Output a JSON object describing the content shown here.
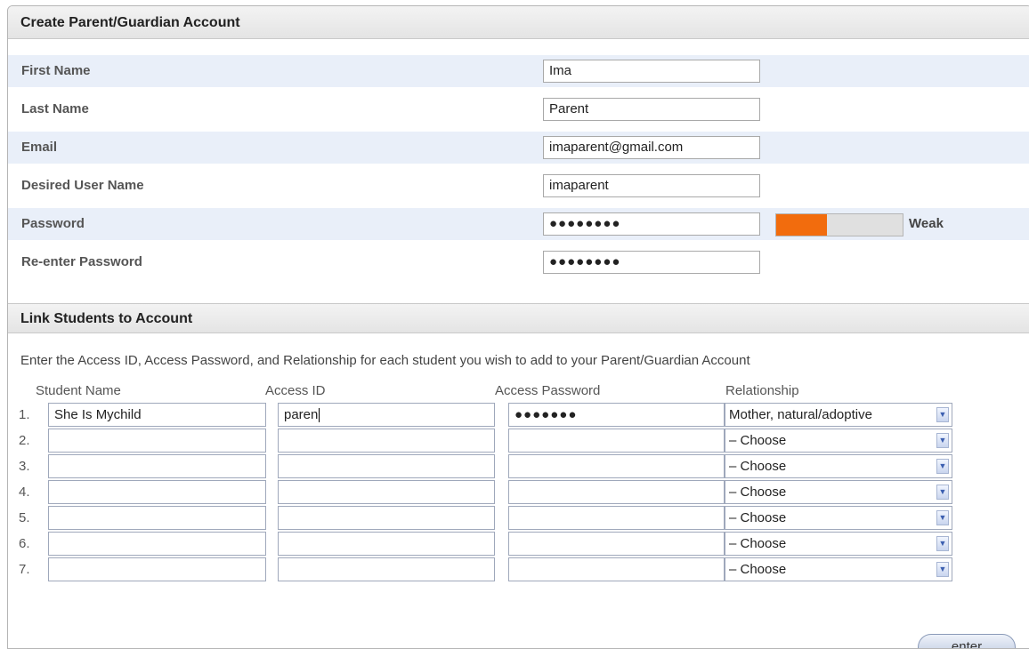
{
  "account": {
    "title": "Create Parent/Guardian Account",
    "fields": {
      "first_name": {
        "label": "First Name",
        "value": "Ima"
      },
      "last_name": {
        "label": "Last Name",
        "value": "Parent"
      },
      "email": {
        "label": "Email",
        "value": "imaparent@gmail.com"
      },
      "username": {
        "label": "Desired User Name",
        "value": "imaparent"
      },
      "password": {
        "label": "Password",
        "value": "●●●●●●●●"
      },
      "reenter_password": {
        "label": "Re-enter Password",
        "value": "●●●●●●●●"
      }
    },
    "strength": {
      "label": "Weak",
      "level": 0.4,
      "color": "#f26c0d"
    }
  },
  "link": {
    "title": "Link Students to Account",
    "instructions": "Enter the Access ID, Access Password, and Relationship for each student you wish to add to your Parent/Guardian Account",
    "columns": {
      "name": "Student Name",
      "access_id": "Access ID",
      "access_password": "Access Password",
      "relationship": "Relationship"
    },
    "rows": [
      {
        "num": "1.",
        "name": "She Is Mychild",
        "access_id": "paren",
        "access_password": "●●●●●●●",
        "relationship": "Mother, natural/adoptive"
      },
      {
        "num": "2.",
        "name": "",
        "access_id": "",
        "access_password": "",
        "relationship": "– Choose"
      },
      {
        "num": "3.",
        "name": "",
        "access_id": "",
        "access_password": "",
        "relationship": "– Choose"
      },
      {
        "num": "4.",
        "name": "",
        "access_id": "",
        "access_password": "",
        "relationship": "– Choose"
      },
      {
        "num": "5.",
        "name": "",
        "access_id": "",
        "access_password": "",
        "relationship": "– Choose"
      },
      {
        "num": "6.",
        "name": "",
        "access_id": "",
        "access_password": "",
        "relationship": "– Choose"
      },
      {
        "num": "7.",
        "name": "",
        "access_id": "",
        "access_password": "",
        "relationship": "– Choose"
      }
    ]
  },
  "actions": {
    "enter_label": "enter"
  }
}
